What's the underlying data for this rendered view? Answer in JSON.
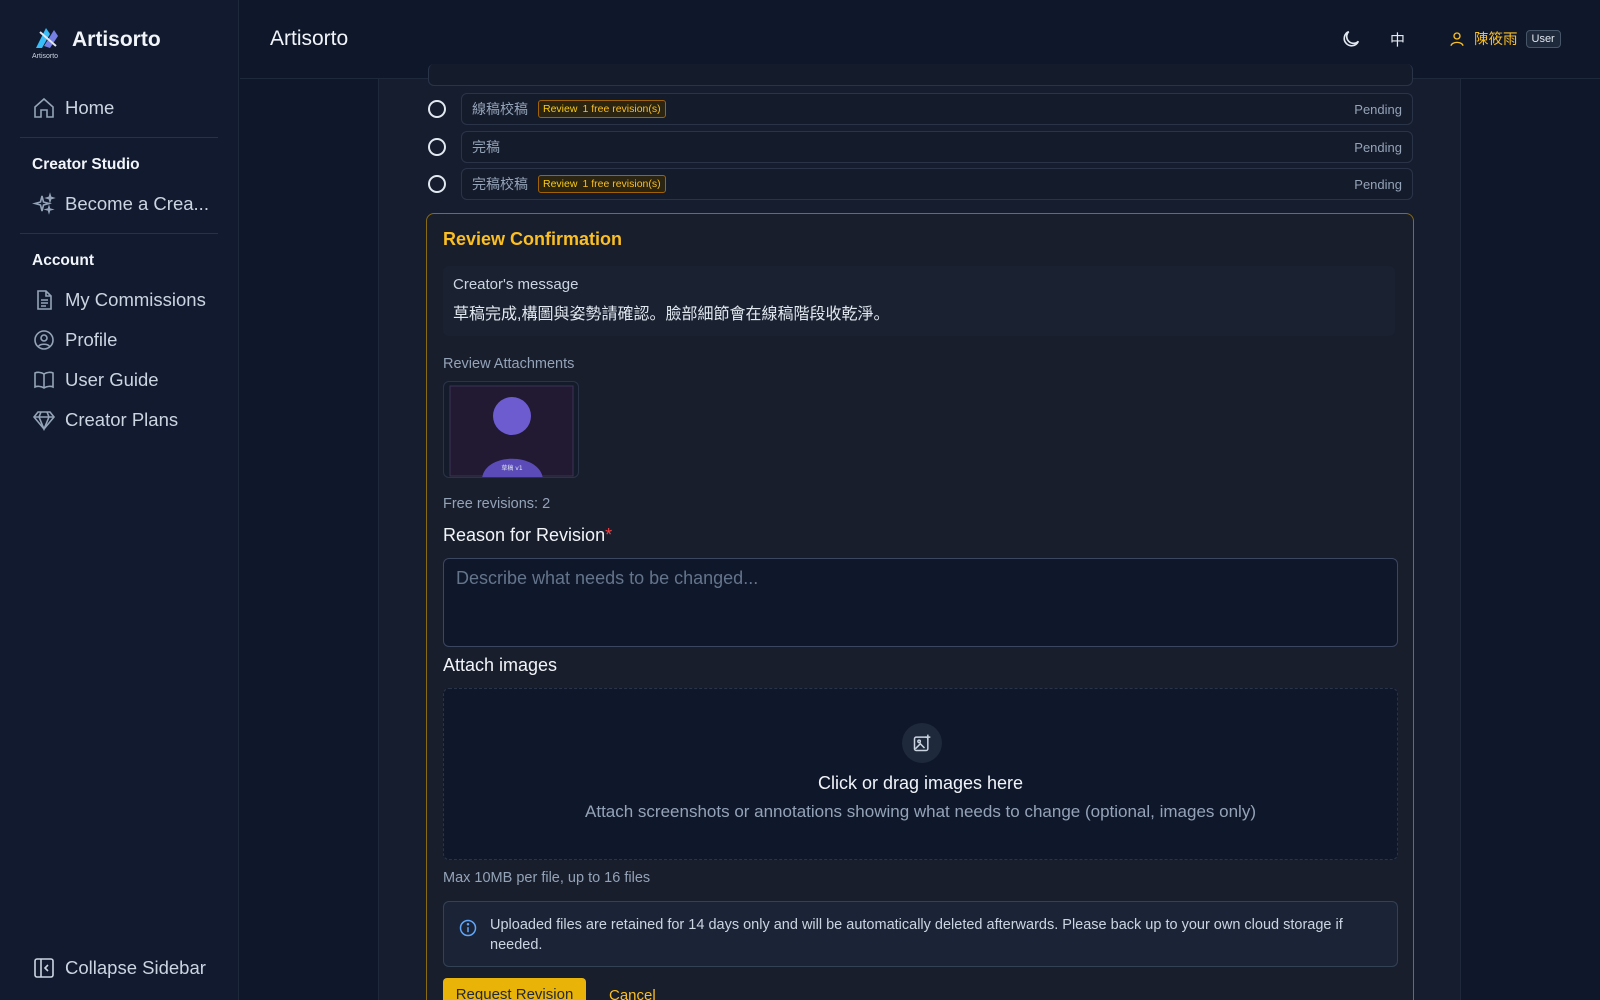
{
  "app": {
    "brand_name": "Artisorto",
    "brand_caption": "Artisorto",
    "header_title": "Artisorto"
  },
  "sidebar": {
    "home_label": "Home",
    "creator_studio_heading": "Creator Studio",
    "become_creator_label": "Become a Crea...",
    "account_heading": "Account",
    "items": [
      {
        "label": "My Commissions",
        "icon": "document-icon"
      },
      {
        "label": "Profile",
        "icon": "user-circle-icon"
      },
      {
        "label": "User Guide",
        "icon": "book-icon"
      },
      {
        "label": "Creator Plans",
        "icon": "diamond-icon"
      }
    ],
    "collapse_label": "Collapse Sidebar"
  },
  "header": {
    "language": "中",
    "user_name": "陳筱雨",
    "user_role": "User"
  },
  "steps": [
    {
      "name": "線稿校稿",
      "tag_type": "Review",
      "tag_note": "1 free revision(s)",
      "status": "Pending"
    },
    {
      "name": "完稿",
      "tag_type": "",
      "tag_note": "",
      "status": "Pending"
    },
    {
      "name": "完稿校稿",
      "tag_type": "Review",
      "tag_note": "1 free revision(s)",
      "status": "Pending"
    }
  ],
  "review": {
    "title": "Review Confirmation",
    "creator_message_label": "Creator's message",
    "creator_message": "草稿完成,構圖與姿勢請確認。臉部細節會在線稿階段收乾淨。",
    "attachments_label": "Review Attachments",
    "attachment_caption": "草稿 v1",
    "free_revisions": "Free revisions: 2",
    "reason_label": "Reason for Revision",
    "reason_required": "*",
    "reason_placeholder": "Describe what needs to be changed...",
    "attach_label": "Attach images",
    "drop_title": "Click or drag images here",
    "drop_subtitle": "Attach screenshots or annotations showing what needs to change (optional, images only)",
    "file_limits": "Max 10MB per file, up to 16 files",
    "retention_notice": "Uploaded files are retained for 14 days only and will be automatically deleted afterwards. Please back up to your own cloud storage if needed.",
    "request_button": "Request Revision",
    "cancel_button": "Cancel"
  },
  "colors": {
    "accent": "#fbbf24",
    "background": "#0f172a",
    "sidebar": "#111a2e",
    "panel": "#161d2e"
  }
}
